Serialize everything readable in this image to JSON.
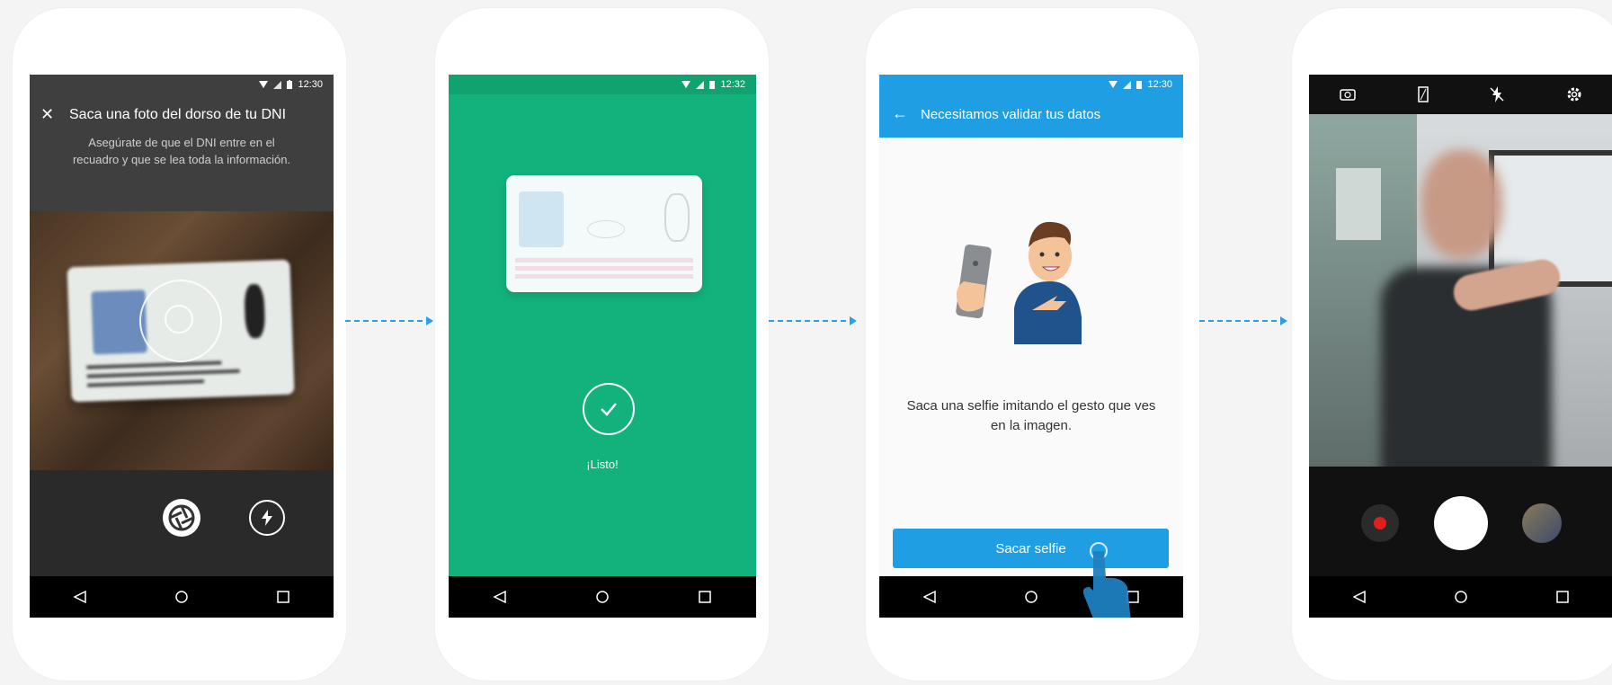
{
  "screens": [
    {
      "status_time": "12:30",
      "title": "Saca una foto del dorso de tu DNI",
      "subtitle": "Asegúrate de que el DNI entre en el recuadro y que se lea toda la información.",
      "icons": [
        "close-icon",
        "shutter-icon",
        "flash-icon"
      ]
    },
    {
      "status_time": "12:32",
      "status_label": "¡Listo!",
      "icons": [
        "checkmark-icon"
      ]
    },
    {
      "status_time": "12:30",
      "title": "Necesitamos validar tus datos",
      "instruction": "Saca una selfie imitando el gesto que ves en la imagen.",
      "button_label": "Sacar selfie",
      "icons": [
        "back-arrow-icon",
        "tap-hand-icon"
      ]
    },
    {
      "top_icons": [
        "switch-camera-icon",
        "aspect-icon",
        "flash-off-icon",
        "settings-icon"
      ],
      "icons": [
        "record-icon",
        "shutter-button",
        "gallery-thumbnail"
      ]
    }
  ],
  "colors": {
    "green": "#13b27c",
    "blue": "#1f9ee3",
    "arrow": "#2a9ee8"
  }
}
